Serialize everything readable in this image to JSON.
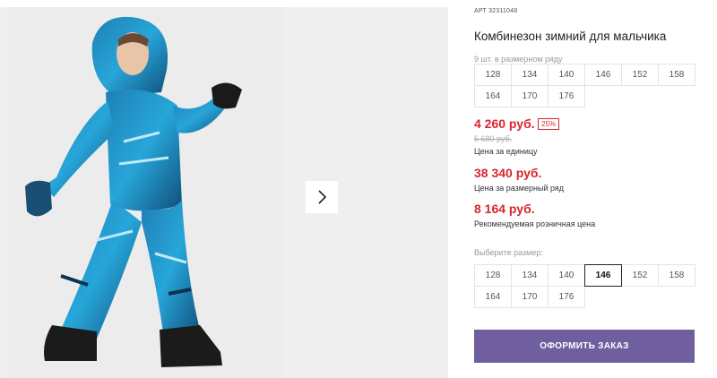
{
  "product": {
    "article_label": "АРТ",
    "article_number": "32311048",
    "title": "Комбинезон зимний для мальчика",
    "size_row_label": "9 шт. в размерном ряду",
    "size_row": [
      "128",
      "134",
      "140",
      "146",
      "152",
      "158",
      "164",
      "170",
      "176"
    ]
  },
  "pricing": {
    "unit_price": "4 260 руб.",
    "discount_badge": "25%",
    "old_price": "5 680 руб.",
    "unit_price_caption": "Цена за единицу",
    "row_price": "38 340 руб.",
    "row_price_caption": "Цена за размерный ряд",
    "retail_price": "8 164 руб.",
    "retail_price_caption": "Рекомендуемая розничная цена",
    "price_color": "#d9262f"
  },
  "size_select": {
    "label": "Выберите размер:",
    "sizes": [
      "128",
      "134",
      "140",
      "146",
      "152",
      "158",
      "164",
      "170",
      "176"
    ],
    "selected": "146"
  },
  "actions": {
    "order_label": "ОФОРМИТЬ ЗАКАЗ",
    "order_color": "#6f5f9f",
    "next_icon": "chevron-right-icon"
  }
}
